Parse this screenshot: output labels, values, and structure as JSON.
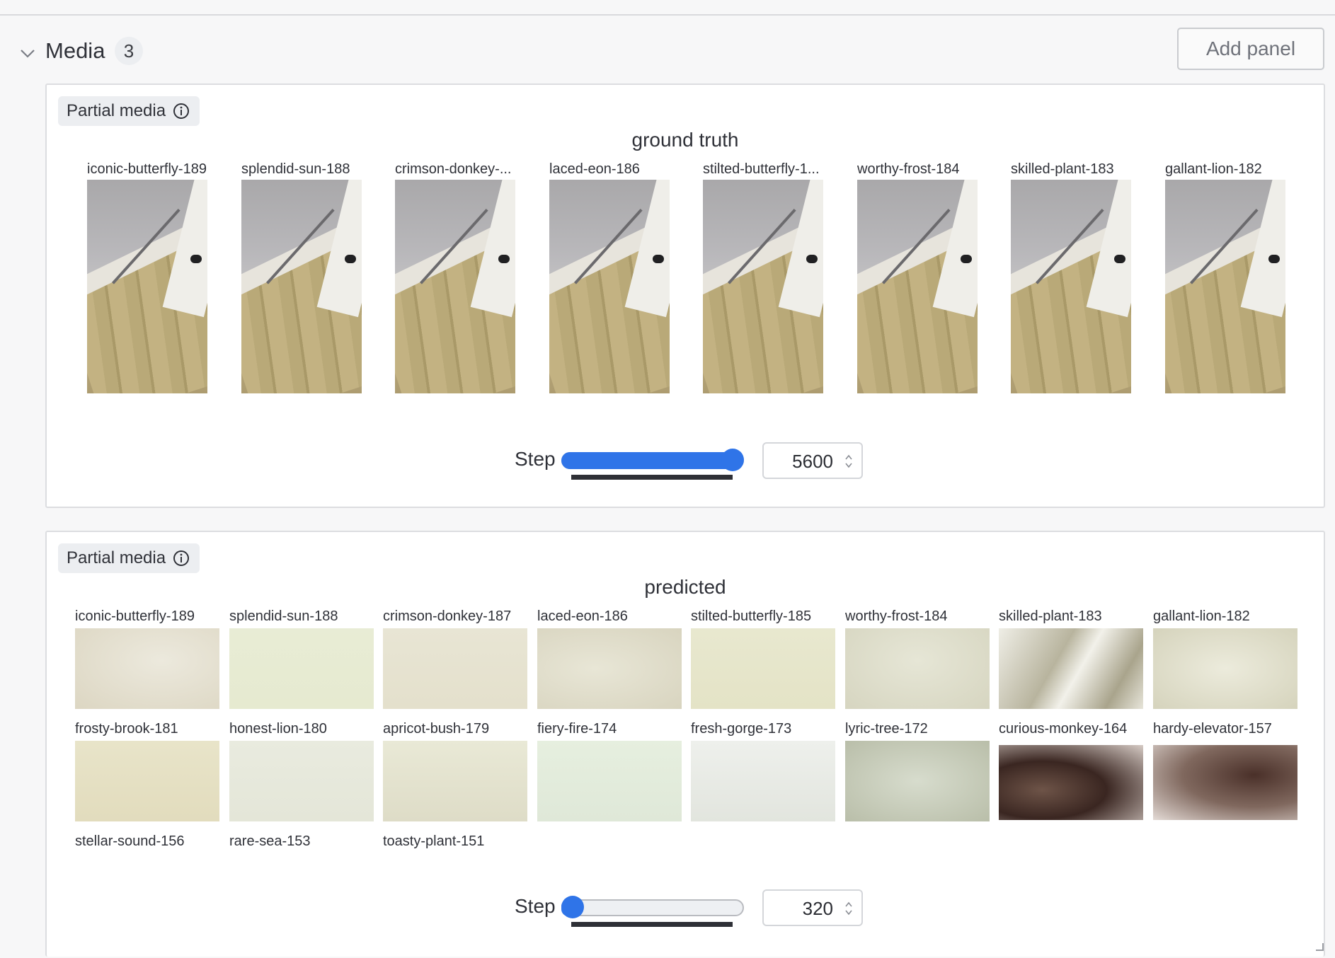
{
  "section": {
    "title": "Media",
    "count": "3",
    "add_panel_label": "Add panel"
  },
  "panels": [
    {
      "chip_label": "Partial media",
      "title": "ground truth",
      "labels": [
        "iconic-butterfly-189",
        "splendid-sun-188",
        "crimson-donkey-...",
        "laced-eon-186",
        "stilted-butterfly-1...",
        "worthy-frost-184",
        "skilled-plant-183",
        "gallant-lion-182"
      ],
      "step_label": "Step",
      "step_value": "5600",
      "slider_fraction": 1.0
    },
    {
      "chip_label": "Partial media",
      "title": "predicted",
      "labels": [
        "iconic-butterfly-189",
        "splendid-sun-188",
        "crimson-donkey-187",
        "laced-eon-186",
        "stilted-butterfly-185",
        "worthy-frost-184",
        "skilled-plant-183",
        "gallant-lion-182",
        "frosty-brook-181",
        "honest-lion-180",
        "apricot-bush-179",
        "fiery-fire-174",
        "fresh-gorge-173",
        "lyric-tree-172",
        "curious-monkey-164",
        "hardy-elevator-157",
        "stellar-sound-156",
        "rare-sea-153",
        "toasty-plant-151"
      ],
      "step_label": "Step",
      "step_value": "320",
      "slider_fraction": 0.0
    }
  ],
  "colors": {
    "accent": "#2f74e8",
    "text": "#2f3138",
    "border": "#dcdde0"
  },
  "icons": {
    "collapse": "chevron-down-icon",
    "info": "info-icon",
    "spinner": "spinner-icon",
    "resize": "resize-handle-icon"
  }
}
